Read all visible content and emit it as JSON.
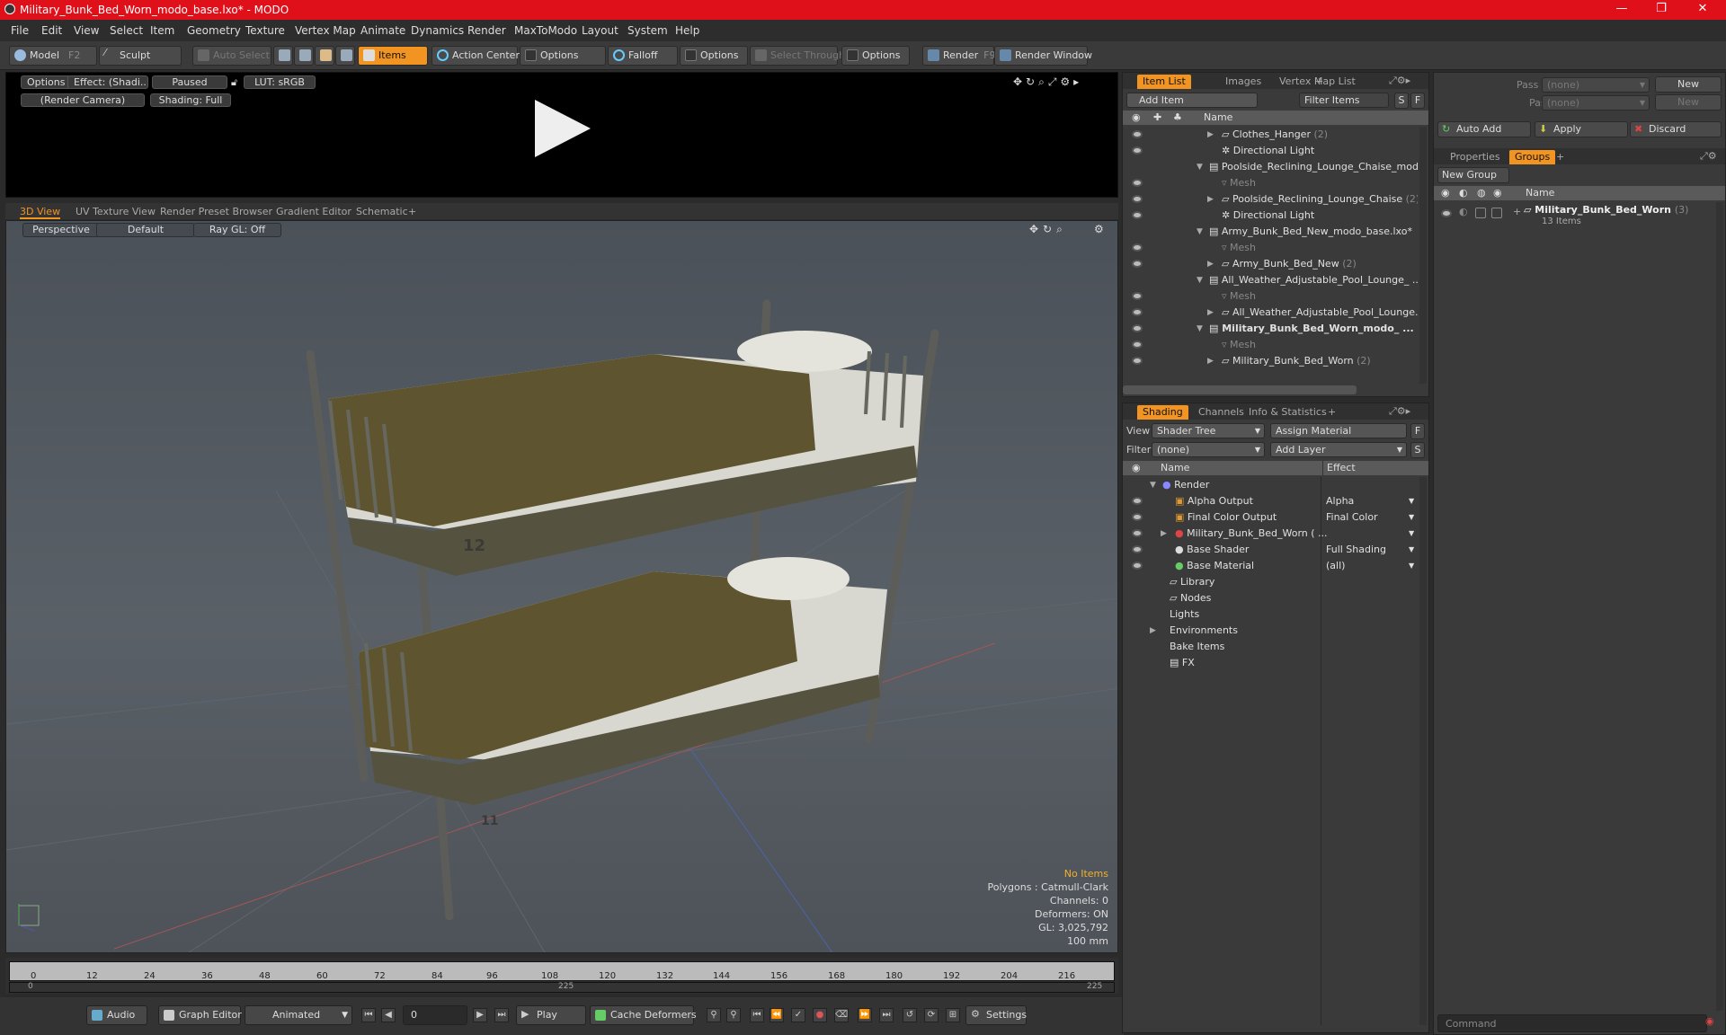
{
  "titlebar": {
    "title": "Military_Bunk_Bed_Worn_modo_base.lxo* - MODO",
    "minimize": "—",
    "restore": "❐",
    "close": "✕"
  },
  "menu": [
    "File",
    "Edit",
    "View",
    "Select",
    "Item",
    "Geometry",
    "Texture",
    "Vertex Map",
    "Animate",
    "Dynamics",
    "Render",
    "MaxToModo",
    "Layout",
    "System",
    "Help"
  ],
  "toolbar": {
    "model": "Model",
    "model_key": "F2",
    "sculpt": "Sculpt",
    "auto_select": "Auto Select",
    "items": "Items",
    "action_center": "Action Center",
    "options1": "Options",
    "falloff": "Falloff",
    "options2": "Options",
    "select_through": "Select Through",
    "options3": "Options",
    "render": "Render",
    "render_key": "F9",
    "render_window": "Render Window"
  },
  "preview": {
    "options": "Options",
    "effect": "Effect: (Shadi...",
    "paused": "Paused",
    "lut": "LUT: sRGB",
    "camera": "(Render Camera)",
    "shading": "Shading: Full"
  },
  "viewport_tabs": [
    "3D View",
    "UV Texture View",
    "Render Preset Browser",
    "Gradient Editor",
    "Schematic",
    "+"
  ],
  "viewport": {
    "perspective": "Perspective",
    "default": "Default",
    "raygl": "Ray GL: Off",
    "label_top": "12",
    "label_bottom": "11"
  },
  "stats": {
    "no_items": "No Items",
    "polygons": "Polygons : Catmull-Clark",
    "channels": "Channels: 0",
    "deformers": "Deformers: ON",
    "gl": "GL: 3,025,792",
    "scale": "100 mm"
  },
  "timeline": {
    "ticks": [
      "0",
      "12",
      "24",
      "36",
      "48",
      "60",
      "72",
      "84",
      "96",
      "108",
      "120",
      "132",
      "144",
      "156",
      "168",
      "180",
      "192",
      "204",
      "216"
    ],
    "sub_start": "0",
    "sub_mid": "225",
    "sub_end": "225"
  },
  "bottombar": {
    "audio": "Audio",
    "graph_editor": "Graph Editor",
    "animated": "Animated",
    "frame": "0",
    "play": "Play",
    "cache": "Cache Deformers",
    "settings": "Settings"
  },
  "itemlist": {
    "tabs": [
      "Item List",
      "Images",
      "Vertex Map List",
      "+"
    ],
    "add_item": "Add Item",
    "filter_items": "Filter Items",
    "s": "S",
    "f": "F",
    "col_name": "Name",
    "rows": [
      {
        "label": "Clothes_Hanger",
        "count": "(2)"
      },
      {
        "label": "Directional Light",
        "count": ""
      },
      {
        "label": "Poolside_Reclining_Lounge_Chaise_mod ...",
        "count": ""
      },
      {
        "label": "Mesh",
        "count": ""
      },
      {
        "label": "Poolside_Reclining_Lounge_Chaise",
        "count": "(2)"
      },
      {
        "label": "Directional Light",
        "count": ""
      },
      {
        "label": "Army_Bunk_Bed_New_modo_base.lxo*",
        "count": ""
      },
      {
        "label": "Mesh",
        "count": ""
      },
      {
        "label": "Army_Bunk_Bed_New",
        "count": "(2)"
      },
      {
        "label": "All_Weather_Adjustable_Pool_Lounge_ ...",
        "count": ""
      },
      {
        "label": "Mesh",
        "count": ""
      },
      {
        "label": "All_Weather_Adjustable_Pool_Lounge...",
        "count": ""
      },
      {
        "label": "Military_Bunk_Bed_Worn_modo_ ...",
        "count": ""
      },
      {
        "label": "Mesh",
        "count": ""
      },
      {
        "label": "Military_Bunk_Bed_Worn",
        "count": "(2)"
      }
    ]
  },
  "shading": {
    "tabs": [
      "Shading",
      "Channels",
      "Info & Statistics",
      "+"
    ],
    "view_label": "View",
    "view_value": "Shader Tree",
    "assign_material": "Assign Material",
    "filter_label": "Filter",
    "filter_value": "(none)",
    "add_layer": "Add Layer",
    "f": "F",
    "s": "S",
    "col_name": "Name",
    "col_effect": "Effect",
    "rows": [
      {
        "label": "Render",
        "effect": ""
      },
      {
        "label": "Alpha Output",
        "effect": "Alpha"
      },
      {
        "label": "Final Color Output",
        "effect": "Final Color"
      },
      {
        "label": "Military_Bunk_Bed_Worn ( ...",
        "effect": ""
      },
      {
        "label": "Base Shader",
        "effect": "Full Shading"
      },
      {
        "label": "Base Material",
        "effect": "(all)"
      },
      {
        "label": "Library",
        "effect": ""
      },
      {
        "label": "Nodes",
        "effect": ""
      },
      {
        "label": "Lights",
        "effect": ""
      },
      {
        "label": "Environments",
        "effect": ""
      },
      {
        "label": "Bake Items",
        "effect": ""
      },
      {
        "label": "FX",
        "effect": ""
      }
    ]
  },
  "groups": {
    "pass_groups_label": "Pass Groups",
    "pass_groups_value": "(none)",
    "new1": "New",
    "passes_label": "Passes",
    "passes_value": "(none)",
    "new2": "New",
    "auto_add": "Auto Add",
    "apply": "Apply",
    "discard": "Discard",
    "tabs": [
      "Properties",
      "Groups",
      "+"
    ],
    "new_group": "New Group",
    "col_name": "Name",
    "group_name": "Military_Bunk_Bed_Worn",
    "group_count": "(3)",
    "group_items": "13 Items"
  },
  "command": {
    "placeholder": "Command"
  }
}
